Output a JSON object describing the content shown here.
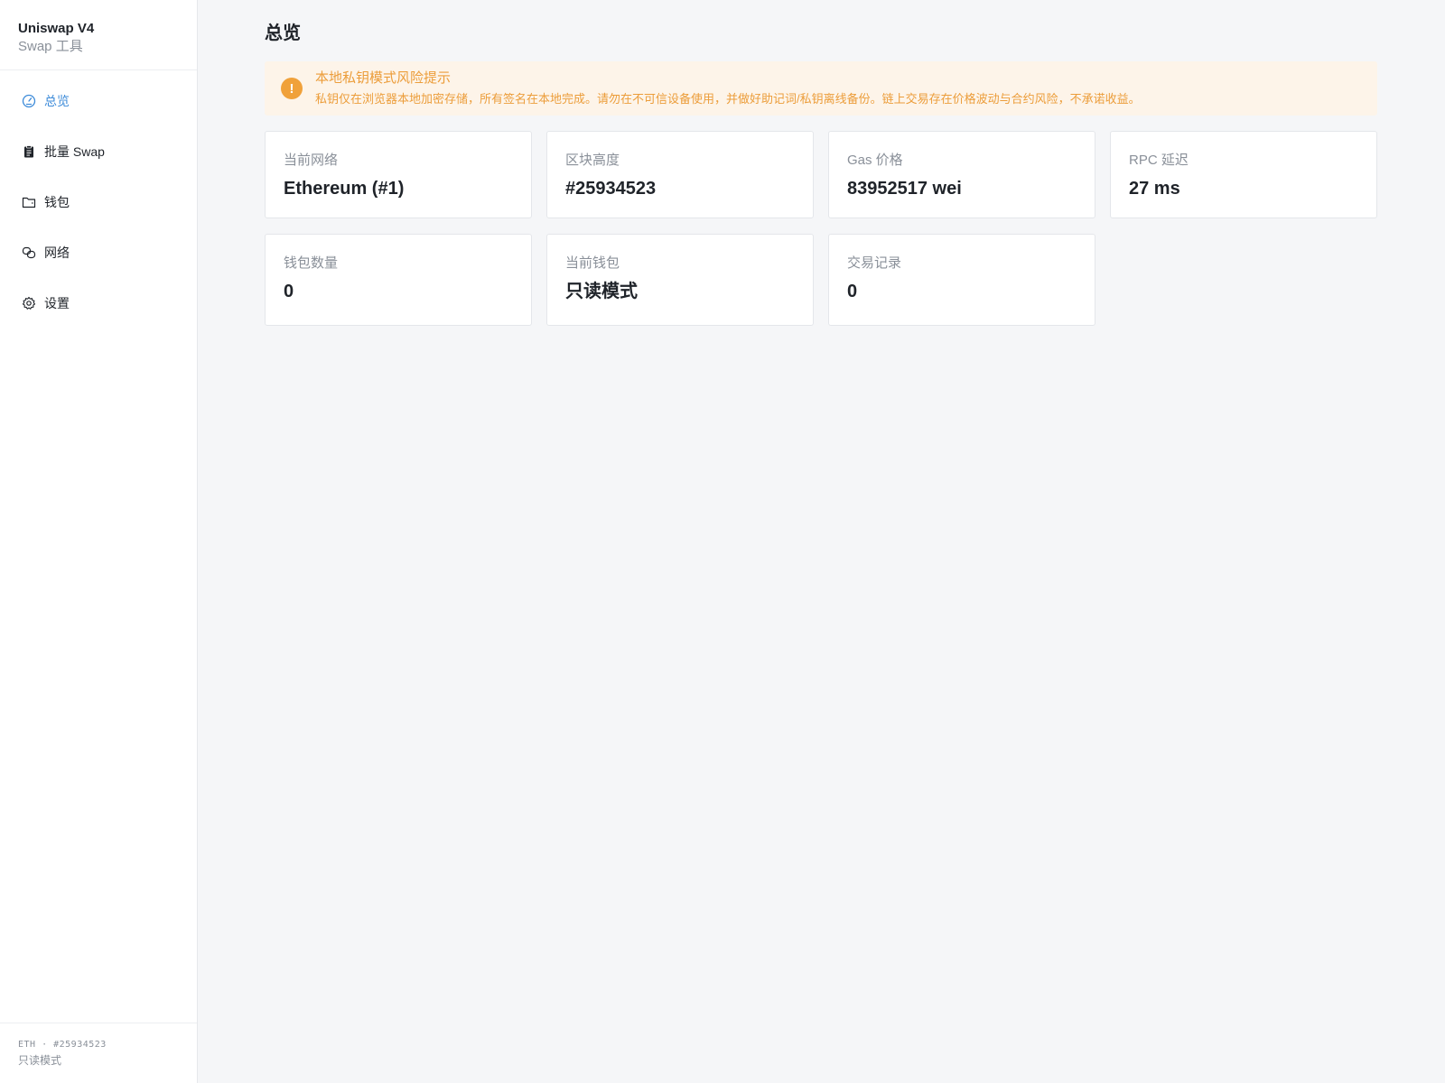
{
  "brand": {
    "title": "Uniswap V4",
    "subtitle": "Swap 工具"
  },
  "nav": [
    {
      "label": "总览",
      "icon": "dashboard-icon",
      "active": true
    },
    {
      "label": "批量 Swap",
      "icon": "clipboard-icon",
      "active": false
    },
    {
      "label": "钱包",
      "icon": "folder-icon",
      "active": false
    },
    {
      "label": "网络",
      "icon": "link-icon",
      "active": false
    },
    {
      "label": "设置",
      "icon": "gear-icon",
      "active": false
    }
  ],
  "footer": {
    "meta": "ETH · #25934523",
    "mode": "只读模式"
  },
  "page": {
    "title": "总览"
  },
  "alert": {
    "title": "本地私钥模式风险提示",
    "description": "私钥仅在浏览器本地加密存储，所有签名在本地完成。请勿在不可信设备使用，并做好助记词/私钥离线备份。链上交易存在价格波动与合约风险，不承诺收益。",
    "icon": "!"
  },
  "stats": [
    {
      "label": "当前网络",
      "value": "Ethereum (#1)"
    },
    {
      "label": "区块高度",
      "value": "#25934523"
    },
    {
      "label": "Gas 价格",
      "value": "83952517 wei"
    },
    {
      "label": "RPC 延迟",
      "value": "27 ms"
    },
    {
      "label": "钱包数量",
      "value": "0"
    },
    {
      "label": "当前钱包",
      "value": "只读模式"
    },
    {
      "label": "交易记录",
      "value": "0"
    }
  ],
  "colors": {
    "accent": "#3d8bd9",
    "warning": "#f0a13a",
    "warning_bg": "#fdf4e9"
  }
}
